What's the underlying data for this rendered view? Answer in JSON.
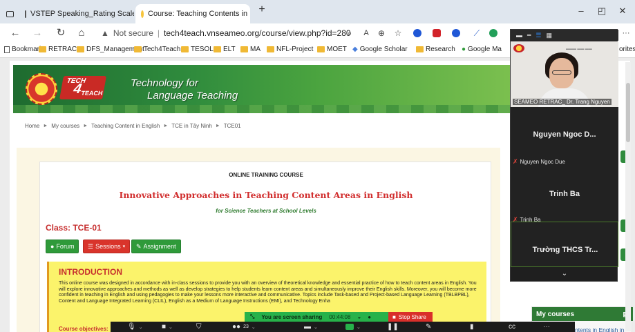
{
  "browser": {
    "tabs": [
      {
        "title": "VSTEP Speaking_Rating Scale.pd",
        "active": false
      },
      {
        "title": "Course: Teaching Contents in En",
        "active": true
      }
    ],
    "new_tab": "+",
    "win_min": "–",
    "win_restore": "◰",
    "win_close": "✕",
    "nav": {
      "back": "←",
      "forward": "→",
      "reload": "↻",
      "home": "⌂"
    },
    "url": {
      "security": "Not secure",
      "text": "tech4teach.vnseameo.org/course/view.php?id=280"
    },
    "more": "···",
    "bookmarks": [
      {
        "label": "Bookmarks",
        "type": "root"
      },
      {
        "label": "RETRAC",
        "type": "folder"
      },
      {
        "label": "DFS_Management",
        "type": "folder"
      },
      {
        "label": "Tech4Teach",
        "type": "folder"
      },
      {
        "label": "TESOL",
        "type": "folder"
      },
      {
        "label": "ELT",
        "type": "folder"
      },
      {
        "label": "MA",
        "type": "folder"
      },
      {
        "label": "NFL-Project",
        "type": "folder"
      },
      {
        "label": "MOET",
        "type": "folder"
      },
      {
        "label": "Google Scholar",
        "type": "link"
      },
      {
        "label": "Research",
        "type": "folder"
      },
      {
        "label": "Google Ma",
        "type": "link"
      },
      {
        "label": "orites",
        "type": "trailing"
      }
    ]
  },
  "site": {
    "banner": {
      "line1": "Technology for",
      "line2": "Language Teaching",
      "badge_top": "TECH",
      "badge_num": "4",
      "badge_bottom": "TEACH"
    },
    "breadcrumb": [
      "Home",
      "My courses",
      "Teaching Content in English",
      "TCE in Tây Ninh",
      "TCE01"
    ],
    "breadcrumb_sep": "►",
    "course": {
      "kicker": "ONLINE TRAINING COURSE",
      "title": "Innovative Approaches in Teaching Content Areas in English",
      "subtitle": "for Science Teachers at School Levels",
      "class_label": "Class: TCE-01",
      "buttons": {
        "forum": "Forum",
        "sessions": "Sessions",
        "assignment": "Assignment"
      },
      "intro_heading": "INTRODUCTION",
      "intro_text": "This online course was designed in accordance with in-class sessions to provide you with an overview of theoretical knowledge and essential practice of how to teach content areas in English. You will explore innovative approaches and methods as well as develop strategies to help students learn content areas and simultaneously improve their English skills. Moreover, you will become more confident in teaching in English and using pedagogies to make your lessons more interactive and communicative. Topics include Task-based and Project-based Language Learning (TBLBPBL), Content and Language Integrated Learning (CLIL), English as a Medium of Language Instructions (EMI), and Technology Enha",
      "objectives_label": "Course objectives:"
    },
    "sidebar": {
      "my_courses_title": "My courses",
      "my_courses_item": "Teaching Contents in English in"
    }
  },
  "zoom": {
    "speaker_name": "SEAMEO RETRAC_ Dr. Trang Nguyen",
    "tiles": [
      {
        "big_name": "Nguyen Ngoc D...",
        "tag": "Nguyen Ngoc Due"
      },
      {
        "big_name": "Trinh Ba",
        "tag": "Trinh Ba"
      },
      {
        "big_name": "Trường THCS Tr...",
        "tag": ""
      }
    ],
    "share_text": "You are screen sharing",
    "share_time": "00:44:08",
    "stop_share": "Stop Share",
    "participants_count": "23",
    "colors": {
      "share_green": "#27b24a",
      "stop_red": "#d92f2a",
      "accent_blue": "#2d8cff"
    }
  },
  "theme": {
    "brand_green": "#2f8b3d",
    "title_red": "#d12e2e",
    "intro_yellow": "#fbf36b"
  }
}
